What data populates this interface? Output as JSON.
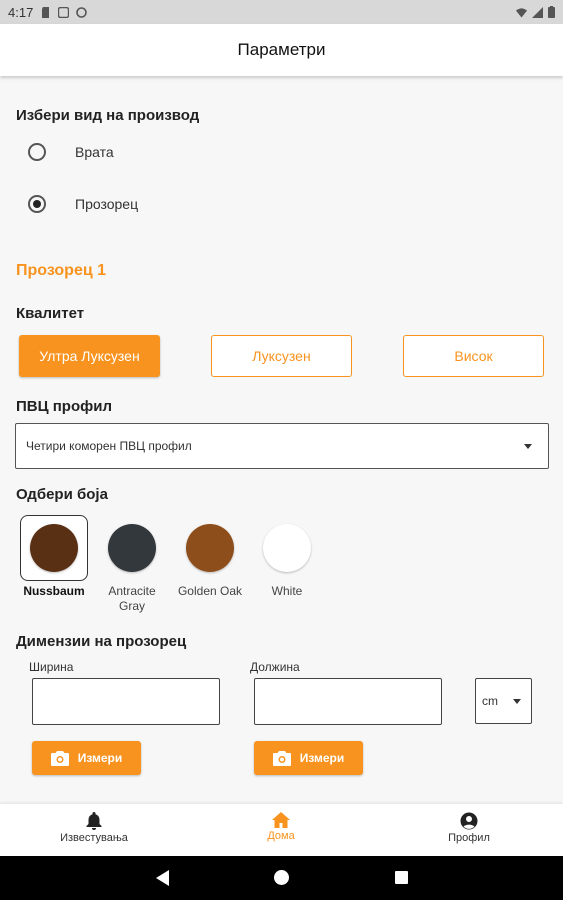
{
  "status": {
    "time": "4:17"
  },
  "appbar": {
    "title": "Параметри"
  },
  "product_type": {
    "label": "Избери вид на производ",
    "options": [
      {
        "label": "Врата",
        "selected": false
      },
      {
        "label": "Прозорец",
        "selected": true
      }
    ]
  },
  "window_title": "Прозорец 1",
  "quality": {
    "label": "Квалитет",
    "options": [
      {
        "label": "Ултра Луксузен",
        "selected": true
      },
      {
        "label": "Луксузен",
        "selected": false
      },
      {
        "label": "Висок",
        "selected": false
      }
    ]
  },
  "profile": {
    "label": "ПВЦ профил",
    "value": "Четири коморен ПВЦ профил"
  },
  "color": {
    "label": "Одбери боја",
    "options": [
      {
        "label": "Nussbaum",
        "hex": "#5a3015",
        "selected": true
      },
      {
        "label": "Antracite Gray",
        "hex": "#33383d",
        "selected": false
      },
      {
        "label": "Golden Oak",
        "hex": "#8e4e1c",
        "selected": false
      },
      {
        "label": "White",
        "hex": "#ffffff",
        "selected": false
      }
    ]
  },
  "dimensions": {
    "label": "Димензии на прозорец",
    "width_label": "Ширина",
    "width_value": "",
    "length_label": "Должина",
    "length_value": "",
    "unit": "cm",
    "measure_label": "Измери"
  },
  "bottom_nav": {
    "items": [
      {
        "label": "Известувања",
        "icon": "bell-icon",
        "active": false
      },
      {
        "label": "Дома",
        "icon": "home-icon",
        "active": true
      },
      {
        "label": "Профил",
        "icon": "account-icon",
        "active": false
      }
    ]
  },
  "colors": {
    "accent": "#f7931e"
  }
}
